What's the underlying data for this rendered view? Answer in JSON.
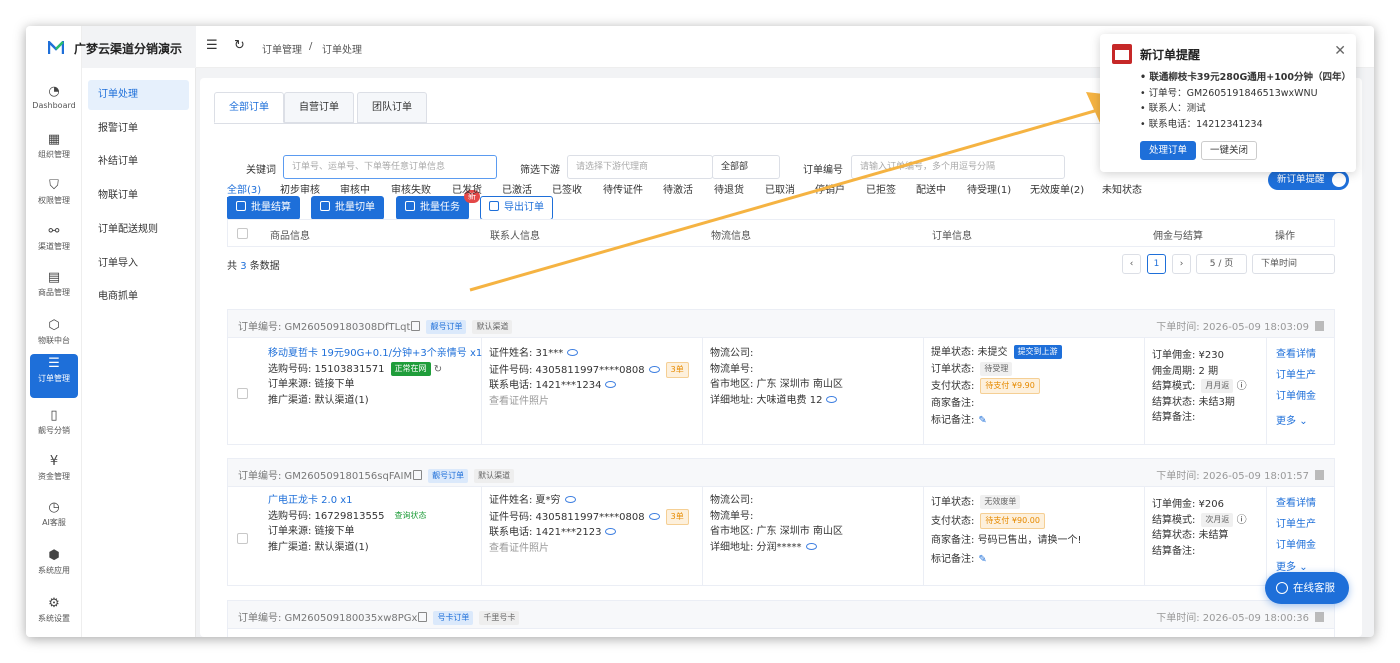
{
  "app": {
    "name": "广梦云渠道分销演示"
  },
  "rail": [
    {
      "label": "Dashboard",
      "icon": "dashboard-icon",
      "glyph": "◔"
    },
    {
      "label": "组织管理",
      "icon": "org-icon",
      "glyph": "▦"
    },
    {
      "label": "权限管理",
      "icon": "shield-icon",
      "glyph": "⛉"
    },
    {
      "label": "渠道管理",
      "icon": "channel-icon",
      "glyph": "⚯"
    },
    {
      "label": "商品管理",
      "icon": "store-icon",
      "glyph": "▤"
    },
    {
      "label": "物联中台",
      "icon": "cube-icon",
      "glyph": "⬡"
    },
    {
      "label": "订单管理",
      "icon": "list-icon",
      "glyph": "☰"
    },
    {
      "label": "靓号分销",
      "icon": "phone-icon",
      "glyph": "▯"
    },
    {
      "label": "资金管理",
      "icon": "yuan-icon",
      "glyph": "¥"
    },
    {
      "label": "AI客服",
      "icon": "ai-icon",
      "glyph": "◷"
    },
    {
      "label": "系统应用",
      "icon": "app-icon",
      "glyph": "⬢"
    },
    {
      "label": "系统设置",
      "icon": "gear-icon",
      "glyph": "⚙"
    }
  ],
  "submenu": [
    "订单处理",
    "报警订单",
    "补结订单",
    "物联订单",
    "订单配送规则",
    "订单导入",
    "电商抓单"
  ],
  "breadcrumb": {
    "first": "订单管理",
    "sep": "/",
    "second": "订单处理"
  },
  "tabs": [
    "全部订单",
    "自营订单",
    "团队订单"
  ],
  "filters": {
    "keyword_label": "关键词",
    "keyword_placeholder": "订单号、运单号、下单等任意订单信息",
    "downstream_label": "筛选下游",
    "downstream_placeholder": "请选择下游代理商",
    "downstream_scope": "全部部",
    "order_no_label": "订单编号",
    "order_no_placeholder": "请输入订单编号，多个用逗号分隔"
  },
  "actions": {
    "batch_settle": "批量结算",
    "batch_cut": "批量切单",
    "batch_task": "批量任务",
    "export": "导出订单",
    "new_badge": "新"
  },
  "status_tabs": [
    "全部(3)",
    "初步审核",
    "审核中",
    "审核失败",
    "已发货",
    "已激活",
    "已签收",
    "待传证件",
    "待激活",
    "待退货",
    "已取消",
    "停销户",
    "已拒签",
    "配送中",
    "待受理(1)",
    "无效废单(2)",
    "未知状态"
  ],
  "table_headers": [
    "商品信息",
    "联系人信息",
    "物流信息",
    "订单信息",
    "佣金与结算",
    "操作"
  ],
  "total": {
    "prefix": "共",
    "count": "3",
    "suffix": "条数据"
  },
  "pagination": {
    "page": "1",
    "per_page": "5 / 页",
    "sort": "下单时间"
  },
  "orders": [
    {
      "order_no": "订单编号: GM260509180308DfTLqt",
      "tag1": "靓号订单",
      "tag2": "默认渠道",
      "time": "下单时间: 2026-05-09 18:03:09",
      "product": "移动夏哲卡 19元90G+0.1/分钟+3个亲情号 x1",
      "number": "选购号码: 15103831571",
      "number_status": "正常在网",
      "source": "订单来源: 链接下单",
      "channel": "推广渠道: 默认渠道(1)",
      "id_name": "证件姓名: 31***",
      "id_no": "证件号码: 4305811997****0808",
      "id_count": "3单",
      "phone": "联系电话: 1421***1234",
      "photos": "查看证件照片",
      "log_company": "物流公司:",
      "log_no": "物流单号:",
      "region": "省市地区: 广东 深圳市 南山区",
      "address": "详细地址: 大味道电费 12",
      "submit_status": "提单状态: 未提交",
      "submit_btn": "提交到上游",
      "order_status": "订单状态:",
      "order_status_tag": "待受理",
      "pay_status": "支付状态:",
      "pay_tag": "待支付 ¥9.90",
      "merchant_note": "商家备注:",
      "mark_note": "标记备注:",
      "commission": "订单佣金: ¥230",
      "cycle": "佣金周期: 2 期",
      "settle_mode": "结算模式:",
      "settle_mode_tag": "月月返",
      "settle_status": "结算状态: 未结3期",
      "settle_note": "结算备注:",
      "ops": [
        "查看详情",
        "订单生产",
        "订单佣金",
        "更多"
      ]
    },
    {
      "order_no": "订单编号: GM260509180156sqFAIM",
      "tag1": "靓号订单",
      "tag2": "默认渠道",
      "time": "下单时间: 2026-05-09 18:01:57",
      "product": "广电正龙卡 2.0 x1",
      "number": "选购号码: 16729813555",
      "number_status": "查询状态",
      "source": "订单来源: 链接下单",
      "channel": "推广渠道: 默认渠道(1)",
      "id_name": "证件姓名: 夏*穷",
      "id_no": "证件号码: 4305811997****0808",
      "id_count": "3单",
      "phone": "联系电话: 1421***2123",
      "photos": "查看证件照片",
      "log_company": "物流公司:",
      "log_no": "物流单号:",
      "region": "省市地区: 广东 深圳市 南山区",
      "address": "详细地址: 分润*****",
      "order_status": "订单状态:",
      "order_status_tag": "无效废单",
      "pay_status": "支付状态:",
      "pay_tag": "待支付 ¥90.00",
      "merchant_note": "商家备注:",
      "merchant_note_val": "号码已售出，请换一个!",
      "mark_note": "标记备注:",
      "commission": "订单佣金: ¥206",
      "settle_mode": "结算模式:",
      "settle_mode_tag": "次月返",
      "settle_status": "结算状态: 未结算",
      "settle_note": "结算备注:",
      "ops": [
        "查看详情",
        "订单生产",
        "订单佣金",
        "更多"
      ]
    },
    {
      "order_no": "订单编号: GM260509180035xw8PGx",
      "tag1": "号卡订单",
      "tag2": "千里号卡",
      "time": "下单时间: 2026-05-09 18:00:36"
    }
  ],
  "notification": {
    "title": "新订单提醒",
    "product": "联通柳枝卡39元280G通用+100分钟（四年）",
    "order_no": "订单号：GM2605191846513wxWNU",
    "contact": "联系人：测试",
    "phone": "联系电话：14212341234",
    "handle_btn": "处理订单",
    "close_all_btn": "一键关闭"
  },
  "toggle_label": "新订单提醒",
  "chat_label": "在线客服",
  "colors": {
    "accent": "#1e6fd9",
    "danger": "#e34848",
    "success": "#1f9d3a",
    "warning": "#e68a00",
    "arrow": "#f5b342"
  }
}
